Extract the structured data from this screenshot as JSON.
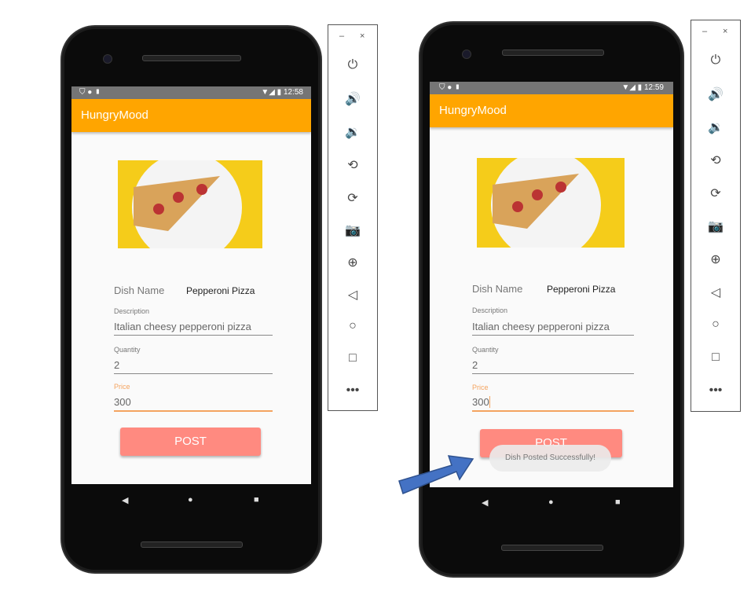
{
  "phones": [
    {
      "time": "12:58",
      "app_title": "HungryMood",
      "dish_name_label": "Dish Name",
      "dish_name_value": "Pepperoni Pizza",
      "description_label": "Description",
      "description_value": "Italian cheesy pepperoni pizza",
      "quantity_label": "Quantity",
      "quantity_value": "2",
      "price_label": "Price",
      "price_value": "300",
      "post_label": "POST"
    },
    {
      "time": "12:59",
      "app_title": "HungryMood",
      "dish_name_label": "Dish Name",
      "dish_name_value": "Pepperoni Pizza",
      "description_label": "Description",
      "description_value": "Italian cheesy pepperoni pizza",
      "quantity_label": "Quantity",
      "quantity_value": "2",
      "price_label": "Price",
      "price_value": "300",
      "post_label": "POST",
      "toast": "Dish Posted Successfully!"
    }
  ],
  "toolbar": {
    "minimize": "–",
    "close": "×",
    "icons": [
      "power",
      "volume-up",
      "volume-down",
      "rotate-left",
      "rotate-right",
      "camera",
      "zoom",
      "back",
      "home",
      "overview",
      "more"
    ]
  },
  "colors": {
    "appbar": "#FFA500",
    "post_button": "#ff8a80",
    "focus": "#f4a460"
  }
}
